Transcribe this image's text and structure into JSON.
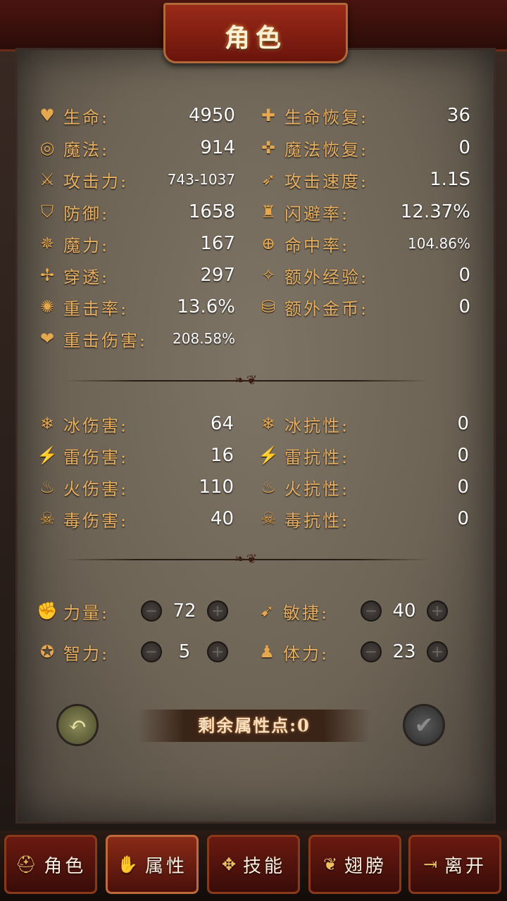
{
  "title": "角色",
  "basic_left": [
    {
      "icon": "heart-icon",
      "glyph": "♥",
      "label": "生命:",
      "value": "4950"
    },
    {
      "icon": "mana-swirl-icon",
      "glyph": "◎",
      "label": "魔法:",
      "value": "914"
    },
    {
      "icon": "sword-icon",
      "glyph": "⚔",
      "label": "攻击力:",
      "value": "743-1037"
    },
    {
      "icon": "shield-icon",
      "glyph": "⛉",
      "label": "防御:",
      "value": "1658"
    },
    {
      "icon": "magic-power-icon",
      "glyph": "✵",
      "label": "魔力:",
      "value": "167"
    },
    {
      "icon": "pierce-icon",
      "glyph": "✢",
      "label": "穿透:",
      "value": "297"
    },
    {
      "icon": "critical-rate-icon",
      "glyph": "✺",
      "label": "重击率:",
      "value": "13.6%"
    },
    {
      "icon": "critical-damage-icon",
      "glyph": "❤",
      "label": "重击伤害:",
      "value": "208.58%"
    }
  ],
  "basic_right": [
    {
      "icon": "life-regen-icon",
      "glyph": "✚",
      "label": "生命恢复:",
      "value": "36"
    },
    {
      "icon": "mana-regen-icon",
      "glyph": "✜",
      "label": "魔法恢复:",
      "value": "0"
    },
    {
      "icon": "attack-speed-icon",
      "glyph": "➶",
      "label": "攻击速度:",
      "value": "1.1S"
    },
    {
      "icon": "dodge-icon",
      "glyph": "♜",
      "label": "闪避率:",
      "value": "12.37%"
    },
    {
      "icon": "crosshair-icon",
      "glyph": "⊕",
      "label": "命中率:",
      "value": "104.86%"
    },
    {
      "icon": "exp-bonus-icon",
      "glyph": "✧",
      "label": "额外经验:",
      "value": "0"
    },
    {
      "icon": "gold-bonus-icon",
      "glyph": "⛁",
      "label": "额外金币:",
      "value": "0"
    }
  ],
  "elem_left": [
    {
      "icon": "ice-icon",
      "glyph": "❄",
      "label": "冰伤害:",
      "value": "64"
    },
    {
      "icon": "lightning-icon",
      "glyph": "⚡",
      "label": "雷伤害:",
      "value": "16"
    },
    {
      "icon": "fire-icon",
      "glyph": "♨",
      "label": "火伤害:",
      "value": "110"
    },
    {
      "icon": "poison-icon",
      "glyph": "☠",
      "label": "毒伤害:",
      "value": "40"
    }
  ],
  "elem_right": [
    {
      "icon": "ice-resist-icon",
      "glyph": "❄",
      "label": "冰抗性:",
      "value": "0"
    },
    {
      "icon": "lightning-resist-icon",
      "glyph": "⚡",
      "label": "雷抗性:",
      "value": "0"
    },
    {
      "icon": "fire-resist-icon",
      "glyph": "♨",
      "label": "火抗性:",
      "value": "0"
    },
    {
      "icon": "poison-resist-icon",
      "glyph": "☠",
      "label": "毒抗性:",
      "value": "0"
    }
  ],
  "attributes": [
    {
      "id": "strength",
      "icon": "fist-icon",
      "glyph": "✊",
      "label": "力量:",
      "value": "72"
    },
    {
      "id": "agility",
      "icon": "runner-icon",
      "glyph": "➹",
      "label": "敏捷:",
      "value": "40"
    },
    {
      "id": "intellect",
      "icon": "brain-icon",
      "glyph": "✪",
      "label": "智力:",
      "value": "5"
    },
    {
      "id": "stamina",
      "icon": "body-icon",
      "glyph": "♟",
      "label": "体力:",
      "value": "23"
    }
  ],
  "minus_glyph": "−",
  "plus_glyph": "+",
  "remaining_points": "剩余属性点:0",
  "tabs": [
    {
      "icon": "helmet-icon",
      "glyph": "⛑",
      "label": "角色"
    },
    {
      "icon": "attribute-icon",
      "glyph": "✋",
      "label": "属性"
    },
    {
      "icon": "skill-icon",
      "glyph": "✥",
      "label": "技能"
    },
    {
      "icon": "wings-icon",
      "glyph": "❦",
      "label": "翅膀"
    },
    {
      "icon": "exit-icon",
      "glyph": "⇥",
      "label": "离开"
    }
  ],
  "active_tab": 1
}
